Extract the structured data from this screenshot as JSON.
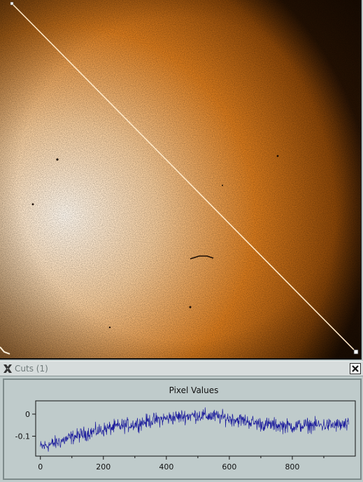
{
  "image_view": {
    "colormap": [
      "#2a1404",
      "#8a4608",
      "#d77a1d",
      "#f2c999",
      "#fff8ee"
    ],
    "cut_line_color": "#ffe9c8"
  },
  "cuts_window": {
    "title": "Cuts (1)",
    "logo_icon": "x-logo-icon",
    "close_icon": "close-icon"
  },
  "chart_data": {
    "type": "line",
    "title": "Pixel Values",
    "xlabel": "",
    "ylabel": "",
    "xlim": [
      -15,
      1000
    ],
    "ylim": [
      -0.19,
      0.06
    ],
    "xticks": [
      0,
      200,
      400,
      600,
      800
    ],
    "xtick_labels": [
      "0",
      "200",
      "400",
      "600",
      "800"
    ],
    "yticks": [
      0,
      -0.1
    ],
    "ytick_labels": [
      "0",
      "-0.1"
    ],
    "grid": false,
    "line_color": "#1c1c9c",
    "series": [
      {
        "name": "",
        "x": [
          0,
          50,
          100,
          150,
          200,
          250,
          300,
          350,
          400,
          450,
          500,
          550,
          600,
          650,
          700,
          750,
          800,
          850,
          900,
          950,
          980
        ],
        "y": [
          -0.15,
          -0.13,
          -0.105,
          -0.085,
          -0.07,
          -0.055,
          -0.045,
          -0.03,
          -0.02,
          -0.01,
          -0.005,
          -0.01,
          -0.02,
          -0.03,
          -0.045,
          -0.05,
          -0.055,
          -0.05,
          -0.05,
          -0.05,
          -0.05
        ]
      }
    ]
  }
}
